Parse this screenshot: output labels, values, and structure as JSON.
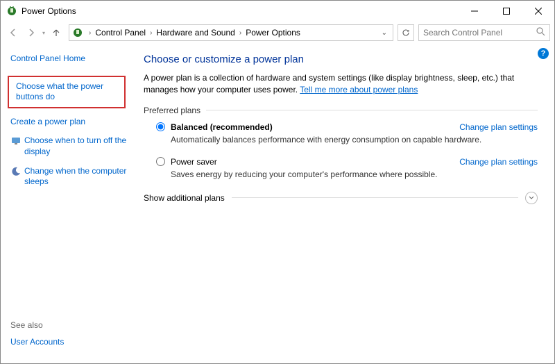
{
  "window": {
    "title": "Power Options"
  },
  "breadcrumb": {
    "items": [
      "Control Panel",
      "Hardware and Sound",
      "Power Options"
    ]
  },
  "search": {
    "placeholder": "Search Control Panel"
  },
  "sidebar": {
    "home": "Control Panel Home",
    "links": [
      {
        "label": "Choose what the power buttons do",
        "highlighted": true
      },
      {
        "label": "Create a power plan"
      },
      {
        "label": "Choose when to turn off the display"
      },
      {
        "label": "Change when the computer sleeps"
      }
    ],
    "see_also_label": "See also",
    "see_also": [
      {
        "label": "User Accounts"
      }
    ]
  },
  "main": {
    "heading": "Choose or customize a power plan",
    "description_pre": "A power plan is a collection of hardware and system settings (like display brightness, sleep, etc.) that manages how your computer uses power. ",
    "description_link": "Tell me more about power plans",
    "preferred_label": "Preferred plans",
    "plans": [
      {
        "name": "Balanced (recommended)",
        "desc": "Automatically balances performance with energy consumption on capable hardware.",
        "selected": true,
        "change_label": "Change plan settings"
      },
      {
        "name": "Power saver",
        "desc": "Saves energy by reducing your computer's performance where possible.",
        "selected": false,
        "change_label": "Change plan settings"
      }
    ],
    "show_additional": "Show additional plans"
  }
}
